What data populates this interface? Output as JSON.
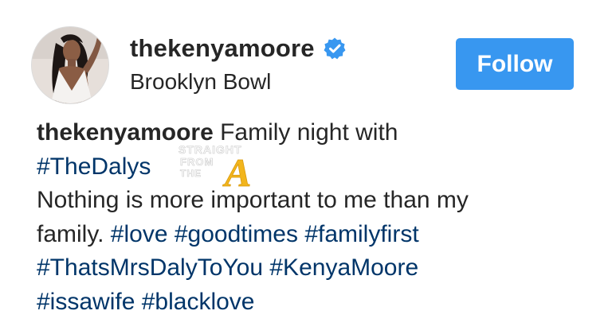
{
  "header": {
    "username": "thekenyamoore",
    "location": "Brooklyn Bowl",
    "follow_label": "Follow",
    "verified_icon": "verified-badge-icon"
  },
  "caption": {
    "author": "thekenyamoore",
    "line1_text": " Family night with",
    "tag_thedalys": "#TheDalys",
    "line3_text": "Nothing is more important to me than my",
    "line4_text": "family. ",
    "tag_love": "#love",
    "tag_goodtimes": "#goodtimes",
    "tag_familyfirst": "#familyfirst",
    "tag_thatsmrsdaly": "#ThatsMrsDalyToYou",
    "tag_kenyamoore": "#KenyaMoore",
    "tag_issawife": "#issawife",
    "tag_blacklove": "#blacklove"
  },
  "watermark": {
    "line1": "STRAIGHT",
    "line2": "FROM",
    "line3": "THE",
    "logo_letter": "A"
  },
  "colors": {
    "follow_bg": "#3897f0",
    "hashtag": "#003569",
    "text": "#262626",
    "verified": "#3897f0",
    "watermark_accent": "#f2b51c"
  }
}
